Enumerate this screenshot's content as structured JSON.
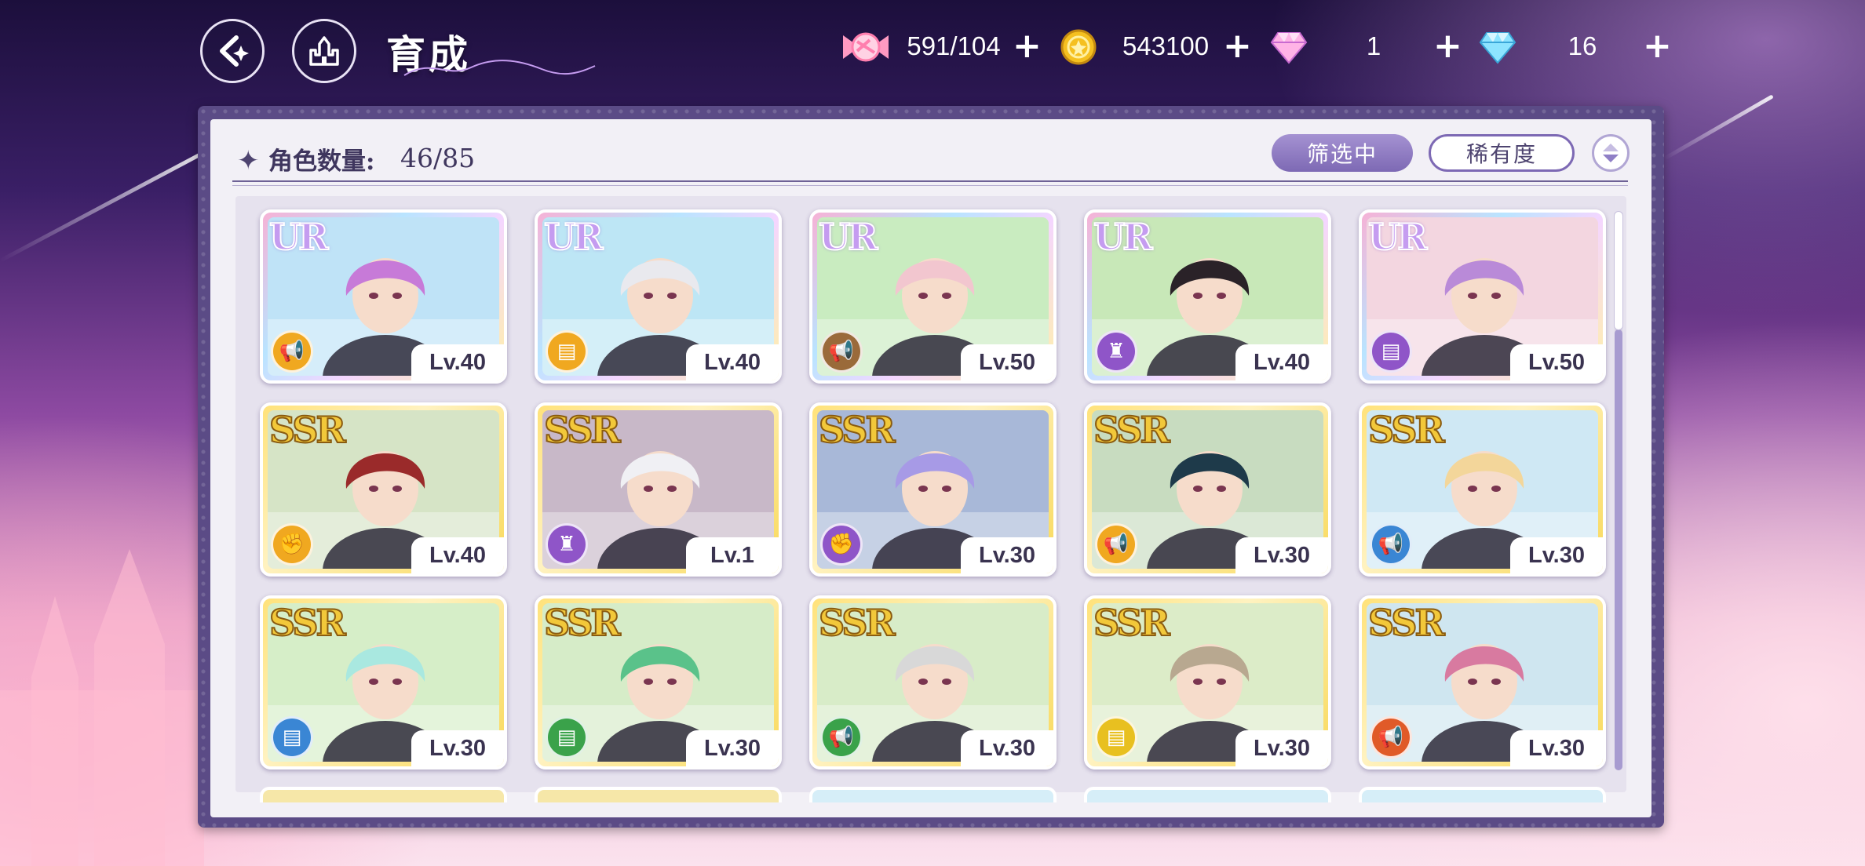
{
  "header": {
    "page_title": "育成",
    "back_icon": "back-arrow-icon",
    "home_icon": "castle-icon"
  },
  "resources": [
    {
      "icon": "candy-icon",
      "value": "591/104",
      "color": "#ff8fb5"
    },
    {
      "icon": "gold-coin-icon",
      "value": "543100",
      "color": "#f5c020"
    },
    {
      "icon": "pink-diamond-icon",
      "value": "1",
      "color": "#ff9ad8"
    },
    {
      "icon": "blue-diamond-icon",
      "value": "16",
      "color": "#6ad6ff"
    }
  ],
  "panel": {
    "count_label": "角色数量:",
    "count_value": "46/85",
    "filter_label": "筛选中",
    "sort_label": "稀有度",
    "sort_order_icon": "sort-order-icon"
  },
  "cards": [
    {
      "rarity": "UR",
      "level": "Lv.40",
      "attr": "megaphone-icon",
      "attr_color": "#f0a820",
      "hair": "#c77ad8",
      "bg": "#bfe3f7"
    },
    {
      "rarity": "UR",
      "level": "Lv.40",
      "attr": "card-icon",
      "attr_color": "#f0a820",
      "hair": "#e9e9ee",
      "bg": "#bde6f5"
    },
    {
      "rarity": "UR",
      "level": "Lv.50",
      "attr": "megaphone-icon",
      "attr_color": "#9a6a3a",
      "hair": "#f2c6cf",
      "bg": "#c9ecc0"
    },
    {
      "rarity": "UR",
      "level": "Lv.40",
      "attr": "boot-icon",
      "attr_color": "#8f55c8",
      "hair": "#2a2228",
      "bg": "#c8e8b8"
    },
    {
      "rarity": "UR",
      "level": "Lv.50",
      "attr": "card-icon",
      "attr_color": "#8f55c8",
      "hair": "#b98ad8",
      "bg": "#f3d6e0"
    },
    {
      "rarity": "SSR",
      "level": "Lv.40",
      "attr": "fist-icon",
      "attr_color": "#f0a820",
      "hair": "#9a2a2a",
      "bg": "#d6e4c6"
    },
    {
      "rarity": "SSR",
      "level": "Lv.1",
      "attr": "boot-icon",
      "attr_color": "#8f55c8",
      "hair": "#f0f0f4",
      "bg": "#c8b8c8"
    },
    {
      "rarity": "SSR",
      "level": "Lv.30",
      "attr": "fist-icon",
      "attr_color": "#8f55c8",
      "hair": "#a79ae6",
      "bg": "#a8b8d8"
    },
    {
      "rarity": "SSR",
      "level": "Lv.30",
      "attr": "megaphone-icon",
      "attr_color": "#f0a820",
      "hair": "#1e3a4a",
      "bg": "#c8dcc0"
    },
    {
      "rarity": "SSR",
      "level": "Lv.30",
      "attr": "megaphone-icon",
      "attr_color": "#3a86d4",
      "hair": "#f3d69a",
      "bg": "#cfe8f4"
    },
    {
      "rarity": "SSR",
      "level": "Lv.30",
      "attr": "card-icon",
      "attr_color": "#3a86d4",
      "hair": "#a9e8e0",
      "bg": "#d6eec8"
    },
    {
      "rarity": "SSR",
      "level": "Lv.30",
      "attr": "card-icon",
      "attr_color": "#3aa24a",
      "hair": "#5ac28a",
      "bg": "#d6ecc8"
    },
    {
      "rarity": "SSR",
      "level": "Lv.30",
      "attr": "megaphone-icon",
      "attr_color": "#3aa24a",
      "hair": "#d8d8d8",
      "bg": "#d8ecc8"
    },
    {
      "rarity": "SSR",
      "level": "Lv.30",
      "attr": "card-icon",
      "attr_color": "#e8c020",
      "hair": "#b8a890",
      "bg": "#dcecc8"
    },
    {
      "rarity": "SSR",
      "level": "Lv.30",
      "attr": "megaphone-icon",
      "attr_color": "#e05a28",
      "hair": "#d87aa0",
      "bg": "#cfe6f0"
    }
  ]
}
